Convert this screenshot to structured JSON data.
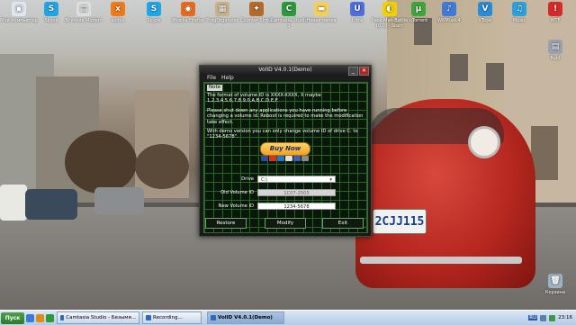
{
  "desktop_icons": [
    {
      "label": "Мой компьютер",
      "color": "#dfe7f2",
      "glyph": "▣"
    },
    {
      "label": "Skype",
      "color": "#1ea6e8",
      "glyph": "S"
    },
    {
      "label": "Вгучкое Modem",
      "color": "#dedede",
      "glyph": "▤"
    },
    {
      "label": "xolfox",
      "color": "#f07a1a",
      "glyph": "x"
    },
    {
      "label": "Skype",
      "color": "#1ea6e8",
      "glyph": "S"
    },
    {
      "label": "Mozilla Firefox",
      "color": "#e86a1c",
      "glyph": "◉"
    },
    {
      "label": "ProgOrganizer",
      "color": "#c8b08a",
      "glyph": "▦"
    },
    {
      "label": "Counter-Strike",
      "color": "#b36a2a",
      "glyph": "✦"
    },
    {
      "label": "Camtasia Studio 7",
      "color": "#2b9a3a",
      "glyph": "C"
    },
    {
      "label": "Новая папка",
      "color": "#f2cf5a",
      "glyph": "▬"
    },
    {
      "label": "Ultra",
      "color": "#4d6fe0",
      "glyph": "U"
    },
    {
      "label": "Pack-Man Battle [0.0] - Stam",
      "color": "#f4d000",
      "glyph": "◐"
    },
    {
      "label": "uTorrent",
      "color": "#3da63a",
      "glyph": "µ"
    },
    {
      "label": "WKMusic4",
      "color": "#3f7bd6",
      "glyph": "♪"
    },
    {
      "label": "VTope",
      "color": "#2a8bd8",
      "glyph": "V"
    },
    {
      "label": "Music",
      "color": "#2aa0dc",
      "glyph": "♫"
    },
    {
      "label": "WTF",
      "color": "#d62a2a",
      "glyph": "!"
    },
    {
      "label": "Rokt",
      "color": "#9aa2ae",
      "glyph": "▤"
    },
    {
      "label": "Корзина",
      "color": "#9fb2c4",
      "glyph": "🗑"
    }
  ],
  "window": {
    "title": "VolID V4.0.1(Demo)",
    "controls": {
      "minimize": "_",
      "close": "✕"
    },
    "menu": [
      "File",
      "Help"
    ],
    "note_tag": "Note",
    "note_paragraphs": [
      "The format of volume ID is XXXX-XXXX, X maybe 1,2,3,4,5,6,7,8,9,0,A,B,C,D,E,F.",
      "Please shut down any applications you have running before changing a volume id. Reboot is required to make the modification take effect.",
      "With demo version you can only change volume ID of drive C: to \"1234-5678\"."
    ],
    "buy_now": "Buy Now",
    "card_colors": [
      "#2a4fa0",
      "#d9321f",
      "#1f78c8",
      "#e0e0e0",
      "#3a62b8",
      "#8c8c8c"
    ],
    "fields": {
      "drive_label": "Drive",
      "drive_value": "C:\\",
      "old_label": "Old Volume ID",
      "old_value": "1C07-2505",
      "new_label": "New Volume ID",
      "new_value": "1234-5678"
    },
    "buttons": {
      "restore": "Restore",
      "modify": "Modify",
      "exit": "Exit"
    }
  },
  "plate_text": "2CJJ115",
  "taskbar": {
    "start_label": "Пуск",
    "quick_launch_colors": [
      "#3a7bd5",
      "#e08a1a",
      "#2a9a3a"
    ],
    "tasks": [
      {
        "label": "Camtasia Studio - Безымя...",
        "active": false
      },
      {
        "label": "Recording...",
        "active": false
      },
      {
        "label": "VolID V4.0.1(Demo)",
        "active": true
      }
    ],
    "language": "RU",
    "clock": "23:16"
  }
}
